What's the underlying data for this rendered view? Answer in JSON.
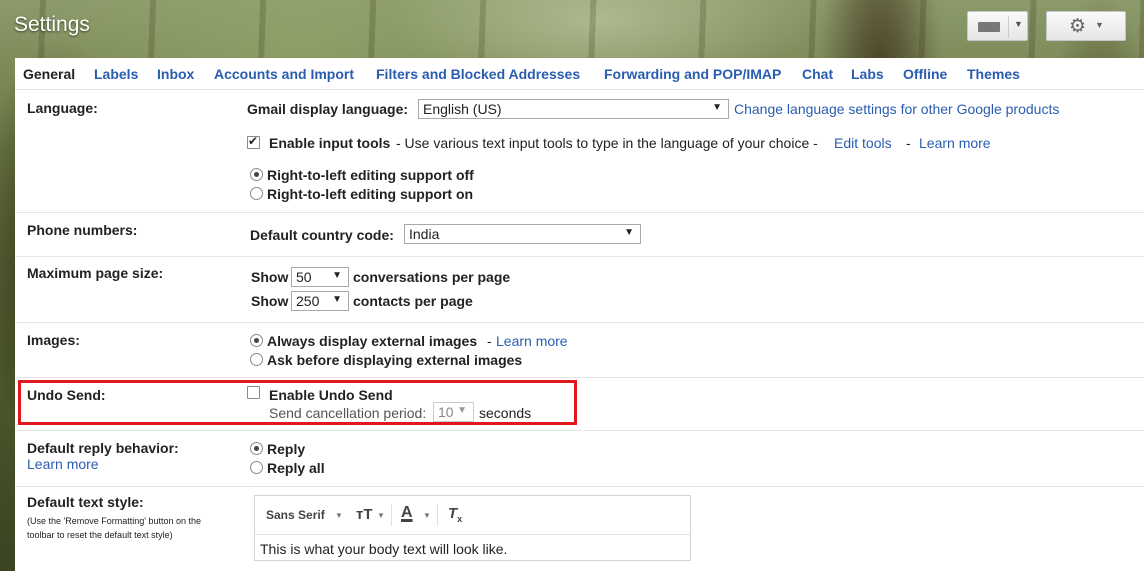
{
  "window": {
    "title": "Settings"
  },
  "topbar": {
    "keyboard_icon": "keyboard-icon",
    "settings_icon": "gear-icon"
  },
  "tabs": [
    {
      "label": "General",
      "active": true
    },
    {
      "label": "Labels"
    },
    {
      "label": "Inbox"
    },
    {
      "label": "Accounts and Import"
    },
    {
      "label": "Filters and Blocked Addresses"
    },
    {
      "label": "Forwarding and POP/IMAP"
    },
    {
      "label": "Chat"
    },
    {
      "label": "Labs"
    },
    {
      "label": "Offline"
    },
    {
      "label": "Themes"
    }
  ],
  "language": {
    "label": "Language:",
    "display_language_label": "Gmail display language:",
    "display_language_value": "English (US)",
    "change_link": "Change language settings for other Google products",
    "input_tools_label": "Enable input tools",
    "input_tools_checked": true,
    "input_tools_desc": "- Use various text input tools to type in the language of your choice -",
    "edit_tools_link": "Edit tools",
    "dash": "-",
    "learn_more": "Learn more",
    "rtl_off": "Right-to-left editing support off",
    "rtl_on": "Right-to-left editing support on"
  },
  "phone": {
    "label": "Phone numbers:",
    "country_code_label": "Default country code:",
    "country_code_value": "India"
  },
  "page_size": {
    "label": "Maximum page size:",
    "show": "Show",
    "conversations_value": "50",
    "conversations_label": "conversations per page",
    "contacts_value": "250",
    "contacts_label": "contacts per page"
  },
  "images": {
    "label": "Images:",
    "always_display": "Always display external images",
    "dash": "-",
    "learn_more": "Learn more",
    "ask_before": "Ask before displaying external images"
  },
  "undo_send": {
    "label": "Undo Send:",
    "enable_label": "Enable Undo Send",
    "period_label": "Send cancellation period:",
    "period_value": "10",
    "seconds": "seconds"
  },
  "reply": {
    "label": "Default reply behavior:",
    "learn_more": "Learn more",
    "reply": "Reply",
    "reply_all": "Reply all"
  },
  "text_style": {
    "label": "Default text style:",
    "note": "(Use the 'Remove Formatting' button on the toolbar to reset the default text style)",
    "font_name": "Sans Serif",
    "sample_text": "This is what your body text will look like."
  },
  "colors": {
    "link": "#2a5db0",
    "highlight": "#e0171f"
  }
}
